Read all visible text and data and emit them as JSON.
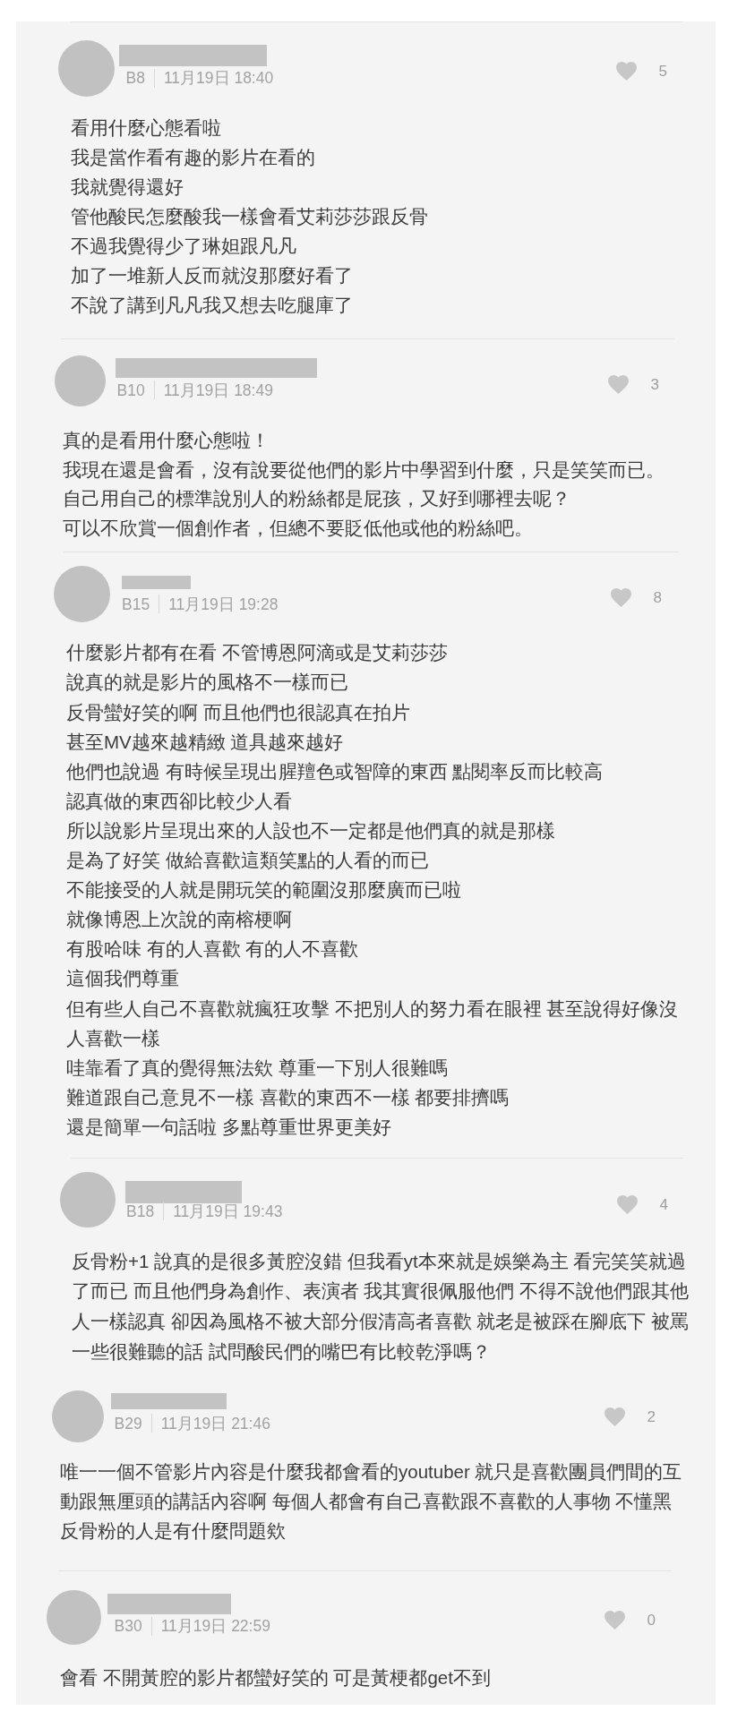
{
  "comments": [
    {
      "floor": "B8",
      "time": "11月19日 18:40",
      "likes": "5",
      "lines": [
        "看用什麼心態看啦",
        "我是當作看有趣的影片在看的",
        "我就覺得還好",
        "管他酸民怎麼酸我一樣會看艾莉莎莎跟反骨",
        "不過我覺得少了琳妲跟凡凡",
        "加了一堆新人反而就沒那麼好看了",
        "不說了講到凡凡我又想去吃腿庫了"
      ]
    },
    {
      "floor": "B10",
      "time": "11月19日 18:49",
      "likes": "3",
      "lines": [
        "真的是看用什麼心態啦！",
        "我現在還是會看，沒有說要從他們的影片中學習到什麼，只是笑笑而已。",
        "自己用自己的標準說別人的粉絲都是屁孩，又好到哪裡去呢？",
        "可以不欣賞一個創作者，但總不要貶低他或他的粉絲吧。"
      ]
    },
    {
      "floor": "B15",
      "time": "11月19日 19:28",
      "likes": "8",
      "lines": [
        "什麼影片都有在看 不管博恩阿滴或是艾莉莎莎",
        "說真的就是影片的風格不一樣而已",
        "反骨蠻好笑的啊 而且他們也很認真在拍片",
        "甚至MV越來越精緻 道具越來越好",
        "他們也說過 有時候呈現出腥羶色或智障的東西 點閱率反而比較高",
        "認真做的東西卻比較少人看",
        "所以說影片呈現出來的人設也不一定都是他們真的就是那樣",
        "是為了好笑 做給喜歡這類笑點的人看的而已",
        "不能接受的人就是開玩笑的範圍沒那麼廣而已啦",
        "就像博恩上次說的南榕梗啊",
        "有股哈味 有的人喜歡 有的人不喜歡",
        "這個我們尊重",
        "但有些人自己不喜歡就瘋狂攻擊 不把別人的努力看在眼裡 甚至說得好像沒",
        "人喜歡一樣",
        "哇靠看了真的覺得無法欸 尊重一下別人很難嗎",
        "難道跟自己意見不一樣 喜歡的東西不一樣 都要排擠嗎",
        "還是簡單一句話啦 多點尊重世界更美好"
      ]
    },
    {
      "floor": "B18",
      "time": "11月19日 19:43",
      "likes": "4",
      "lines": [
        "反骨粉+1 說真的是很多黃腔沒錯 但我看yt本來就是娛樂為主 看完笑笑就過",
        "了而已 而且他們身為創作、表演者 我其實很佩服他們 不得不說他們跟其他",
        "人一樣認真 卻因為風格不被大部分假清高者喜歡 就老是被踩在腳底下 被罵",
        "一些很難聽的話 試問酸民們的嘴巴有比較乾淨嗎？"
      ]
    },
    {
      "floor": "B29",
      "time": "11月19日 21:46",
      "likes": "2",
      "lines": [
        "唯一一個不管影片內容是什麼我都會看的youtuber 就只是喜歡團員們間的互",
        "動跟無厘頭的講話內容啊 每個人都會有自己喜歡跟不喜歡的人事物 不懂黑",
        "反骨粉的人是有什麼問題欸"
      ]
    },
    {
      "floor": "B30",
      "time": "11月19日 22:59",
      "likes": "0",
      "lines": [
        "會看 不開黃腔的影片都蠻好笑的 可是黃梗都get不到"
      ]
    }
  ]
}
